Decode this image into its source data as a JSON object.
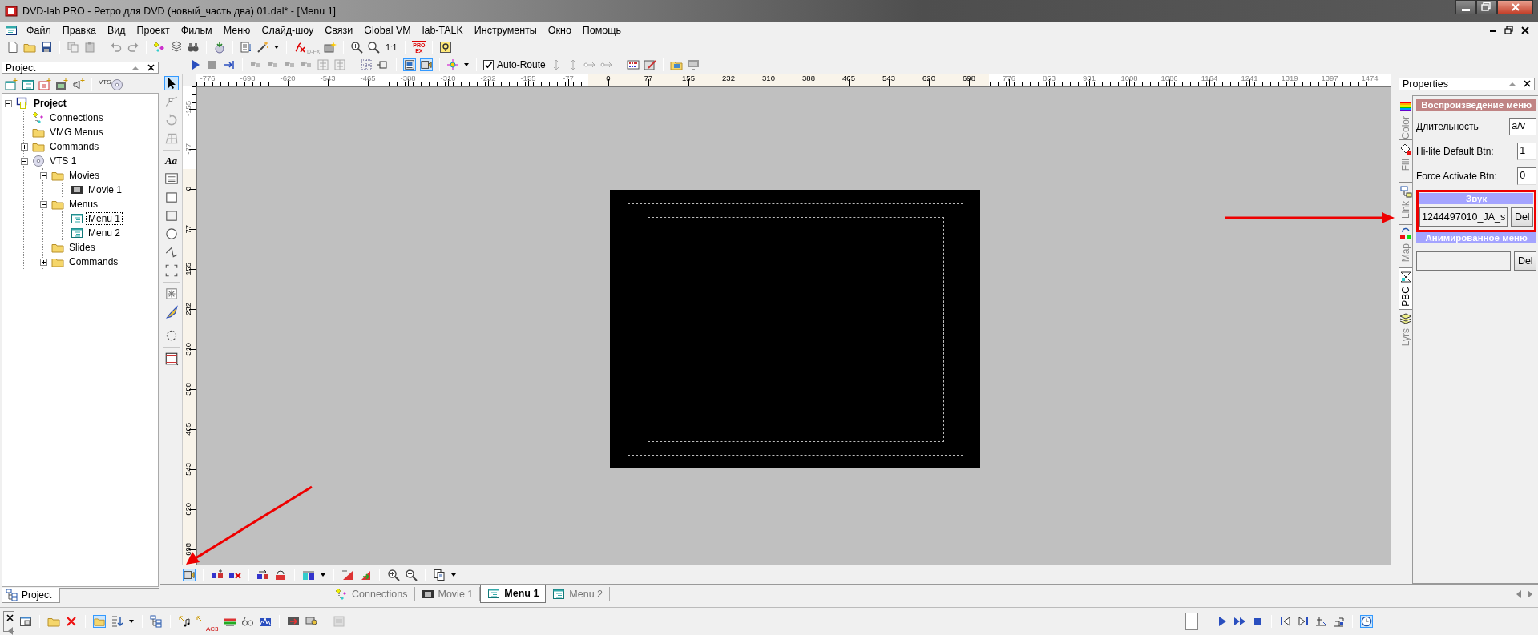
{
  "window": {
    "title": "DVD-lab PRO - Ретро для DVD (новый_часть два) 01.dal* - [Menu 1]"
  },
  "menu_bar": {
    "items": [
      "Файл",
      "Правка",
      "Вид",
      "Проект",
      "Фильм",
      "Меню",
      "Слайд-шоу",
      "Связи",
      "Global VM",
      "lab-TALK",
      "Инструменты",
      "Окно",
      "Помощь"
    ]
  },
  "toolbar": {
    "dfx_label": "D-FX",
    "zoom_label": "1:1",
    "pro_ex_label": [
      "PRO",
      "EX"
    ],
    "auto_route": {
      "label": "Auto-Route",
      "checked": true
    }
  },
  "project_panel": {
    "title": "Project",
    "toolbar_badge": "VTS",
    "tree": [
      {
        "label": "Project",
        "kind": "project",
        "expanded": true,
        "selected": false,
        "children": [
          {
            "label": "Connections",
            "kind": "connections",
            "selected": false
          },
          {
            "label": "VMG Menus",
            "kind": "folder",
            "selected": false
          },
          {
            "label": "Commands",
            "kind": "folder",
            "expanded": false,
            "selected": false
          },
          {
            "label": "VTS 1",
            "kind": "disc",
            "expanded": true,
            "selected": false,
            "children": [
              {
                "label": "Movies",
                "kind": "folder",
                "expanded": true,
                "selected": false,
                "children": [
                  {
                    "label": "Movie 1",
                    "kind": "movie",
                    "selected": false
                  }
                ]
              },
              {
                "label": "Menus",
                "kind": "folder",
                "expanded": true,
                "selected": false,
                "children": [
                  {
                    "label": "Menu 1",
                    "kind": "menu",
                    "selected": true
                  },
                  {
                    "label": "Menu 2",
                    "kind": "menu",
                    "selected": false
                  }
                ]
              },
              {
                "label": "Slides",
                "kind": "folder",
                "selected": false
              },
              {
                "label": "Commands",
                "kind": "folder",
                "expanded": false,
                "selected": false
              }
            ]
          }
        ]
      }
    ],
    "tab": {
      "label": "Project",
      "selected": true
    }
  },
  "tool_strip": {
    "text_tool_label": "Aa"
  },
  "ruler": {
    "horizontal": [
      {
        "label": "-776",
        "highlighted": false
      },
      {
        "label": "-698",
        "highlighted": false
      },
      {
        "label": "-620",
        "highlighted": false
      },
      {
        "label": "-543",
        "highlighted": false
      },
      {
        "label": "-465",
        "highlighted": false
      },
      {
        "label": "-388",
        "highlighted": false
      },
      {
        "label": "-310",
        "highlighted": false
      },
      {
        "label": "-232",
        "highlighted": false
      },
      {
        "label": "-155",
        "highlighted": false
      },
      {
        "label": "-77",
        "highlighted": false
      },
      {
        "label": "0",
        "highlighted": true
      },
      {
        "label": "77",
        "highlighted": true
      },
      {
        "label": "155",
        "highlighted": true
      },
      {
        "label": "232",
        "highlighted": true
      },
      {
        "label": "310",
        "highlighted": true
      },
      {
        "label": "388",
        "highlighted": true
      },
      {
        "label": "465",
        "highlighted": true
      },
      {
        "label": "543",
        "highlighted": true
      },
      {
        "label": "620",
        "highlighted": true
      },
      {
        "label": "698",
        "highlighted": true
      },
      {
        "label": "776",
        "highlighted": false
      },
      {
        "label": "853",
        "highlighted": false
      },
      {
        "label": "931",
        "highlighted": false
      },
      {
        "label": "1008",
        "highlighted": false
      },
      {
        "label": "1086",
        "highlighted": false
      },
      {
        "label": "1164",
        "highlighted": false
      },
      {
        "label": "1241",
        "highlighted": false
      },
      {
        "label": "1319",
        "highlighted": false
      },
      {
        "label": "1397",
        "highlighted": false
      },
      {
        "label": "1474",
        "highlighted": false
      }
    ],
    "vertical": [
      {
        "label": "-155",
        "highlighted": false
      },
      {
        "label": "-77",
        "highlighted": false
      },
      {
        "label": "0",
        "highlighted": true
      },
      {
        "label": "77",
        "highlighted": true
      },
      {
        "label": "155",
        "highlighted": true
      },
      {
        "label": "232",
        "highlighted": true
      },
      {
        "label": "310",
        "highlighted": true
      },
      {
        "label": "388",
        "highlighted": true
      },
      {
        "label": "465",
        "highlighted": true
      },
      {
        "label": "543",
        "highlighted": true
      },
      {
        "label": "620",
        "highlighted": true
      },
      {
        "label": "698",
        "highlighted": true
      }
    ]
  },
  "document_tabs": [
    {
      "label": "Connections",
      "kind": "connections",
      "selected": false
    },
    {
      "label": "Movie 1",
      "kind": "movie",
      "selected": false
    },
    {
      "label": "Menu 1",
      "kind": "menu",
      "selected": true
    },
    {
      "label": "Menu 2",
      "kind": "menu",
      "selected": false
    }
  ],
  "properties": {
    "title": "Properties",
    "side_tabs": [
      {
        "label": "Color",
        "kind": "color",
        "selected": false
      },
      {
        "label": "Fill",
        "kind": "fill",
        "selected": false
      },
      {
        "label": "Link",
        "kind": "link",
        "selected": false
      },
      {
        "label": "Map",
        "kind": "map",
        "selected": false
      },
      {
        "label": "PBC",
        "kind": "pbc",
        "selected": true
      },
      {
        "label": "Lyrs",
        "kind": "layers",
        "selected": false
      }
    ],
    "playback": {
      "heading": "Воспроизведение меню",
      "fields": [
        {
          "label": "Длительность",
          "value": "a/v"
        },
        {
          "label": "Hi-lite Default Btn:",
          "value": "1"
        },
        {
          "label": "Force Activate Btn:",
          "value": "0"
        }
      ]
    },
    "sound": {
      "heading": "Звук",
      "value": "1244497010_JA_s",
      "button": "Del"
    },
    "animation": {
      "heading": "Анимированное меню",
      "button": "Del"
    }
  },
  "status_toolbar": {
    "ac3_label": "AC3"
  }
}
